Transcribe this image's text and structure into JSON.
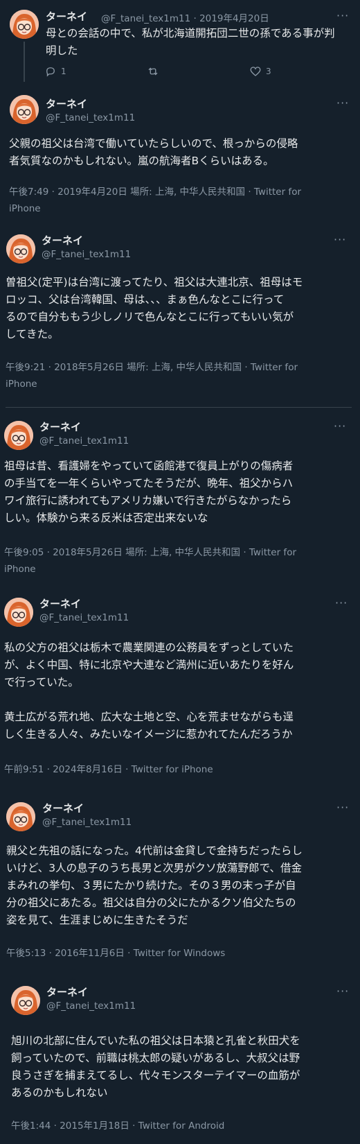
{
  "more_glyph": "···",
  "tweets": [
    {
      "name": "ターネイ",
      "handle": "@F_tanei_tex1m11",
      "handle_date": "@F_tanei_tex1m11 · 2019年4月20日",
      "text": "母との会話の中で、私が北海道開拓団二世の孫である事が判\n明した",
      "actions": {
        "reply_count": "1",
        "like_count": "3"
      }
    },
    {
      "name": "ターネイ",
      "handle": "@F_tanei_tex1m11",
      "text": "父親の祖父は台湾で働いていたらしいので、根っからの侵略\n者気質なのかもしれない。嵐の航海者Bくらいはある。",
      "meta": "午後7:49 · 2019年4月20日 場所: 上海, 中华人民共和国 · Twitter for\niPhone"
    },
    {
      "name": "ターネイ",
      "handle": "@F_tanei_tex1m11",
      "text": "曽祖父(定平)は台湾に渡ってたり、祖父は大連北京、祖母はモ\nロッコ、父は台湾韓国、母は、、、まぁ色んなとこに行って\nるので自分ももう少しノリで色んなとこに行ってもいい気が\nしてきた。",
      "meta": "午後9:21 · 2018年5月26日 場所: 上海, 中华人民共和国 · Twitter for\niPhone"
    },
    {
      "name": "ターネイ",
      "handle": "@F_tanei_tex1m11",
      "text": "祖母は昔、看護婦をやっていて函館港で復員上がりの傷病者\nの手当てを一年くらいやってたそうだが、晩年、祖父からハ\nワイ旅行に誘われてもアメリカ嫌いで行きたがらなかったら\nしい。体験から来る反米は否定出来ないな",
      "meta": "午後9:05 · 2018年5月26日 場所: 上海, 中华人民共和国 · Twitter for\niPhone"
    },
    {
      "name": "ターネイ",
      "handle": "@F_tanei_tex1m11",
      "text": "私の父方の祖父は栃木で農業関連の公務員をずっとしていた\nが、よく中国、特に北京や大連など満州に近いあたりを好ん\nで行っていた。\n\n黄土広がる荒れ地、広大な土地と空、心を荒ませながらも逞\nしく生きる人々、みたいなイメージに惹かれてたんだろうか",
      "meta": "午前9:51 · 2024年8月16日 · Twitter for iPhone"
    },
    {
      "name": "ターネイ",
      "handle": "@F_tanei_tex1m11",
      "text": "親父と先祖の話になった。4代前は金貸しで金持ちだったらし\nいけど、3人の息子のうち長男と次男がクソ放蕩野郎で、借金\nまみれの挙句、３男にたかり続けた。その３男の末っ子が自\n分の祖父にあたる。祖父は自分の父にたかるクソ伯父たちの\n姿を見て、生涯まじめに生きたそうだ",
      "meta": "午後5:13 · 2016年11月6日 · Twitter for Windows"
    },
    {
      "name": "ターネイ",
      "handle": "@F_tanei_tex1m11",
      "text": "旭川の北部に住んでいた私の祖父は日本猿と孔雀と秋田犬を\n飼っていたので、前職は桃太郎の疑いがあるし、大叔父は野\n良うさぎを捕まえてるし、代々モンスターテイマーの血筋が\nあるのかもしれない",
      "meta": "午後1:44 · 2015年1月18日 · Twitter for Android"
    }
  ]
}
